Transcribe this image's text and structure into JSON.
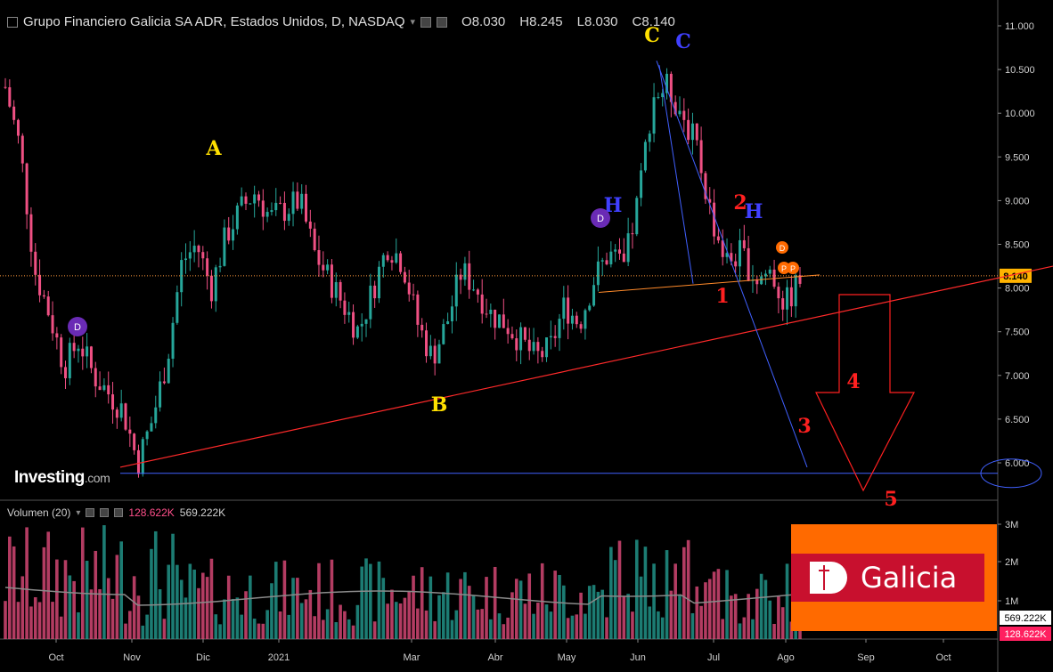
{
  "header": {
    "title": "Grupo Financiero Galicia SA ADR, Estados Unidos, D, NASDAQ",
    "open": "O8.030",
    "high": "H8.245",
    "low": "L8.030",
    "close": "C8.140"
  },
  "volume_header": {
    "label": "Volumen (20)",
    "value1": "128.622K",
    "value2": "569.222K"
  },
  "logo": {
    "brand": "Investing",
    "suffix": ".com"
  },
  "galicia_logo": {
    "text": "Galicia"
  },
  "colors": {
    "up": "#26a69a",
    "down": "#ef5083",
    "trendline": "#ff2a2a",
    "blue_line": "#4060ff",
    "wave_yellow": "#ffe000",
    "wave_blue": "#4040ff",
    "wave_red": "#ff2020",
    "price_tag": "#ffb300"
  },
  "chart_data": {
    "type": "candlestick",
    "title": "Grupo Financiero Galicia SA ADR, Estados Unidos, D, NASDAQ",
    "price_axis": {
      "ticks": [
        "11.000",
        "10.500",
        "10.000",
        "9.500",
        "9.000",
        "8.500",
        "8.000",
        "7.500",
        "7.000",
        "6.500",
        "6.000"
      ],
      "range": [
        5.85,
        11.15
      ],
      "current_price": "8.140"
    },
    "volume_axis": {
      "ticks": [
        "3M",
        "2M",
        "1M"
      ],
      "labels": {
        "ma": "569.222K",
        "last": "128.622K"
      }
    },
    "time_axis": [
      "Oct",
      "Nov",
      "Dic",
      "2021",
      "Mar",
      "Abr",
      "May",
      "Jun",
      "Jul",
      "Ago",
      "Sep",
      "Oct"
    ],
    "price_path": [
      [
        "Sep",
        10.3
      ],
      [
        "Sep",
        9.6
      ],
      [
        "Sep",
        8.2
      ],
      [
        "Sep",
        7.7
      ],
      [
        "Oct",
        7.1
      ],
      [
        "Oct",
        7.4
      ],
      [
        "Oct",
        7.0
      ],
      [
        "Oct",
        6.8
      ],
      [
        "Oct",
        6.6
      ],
      [
        "Nov",
        6.0
      ],
      [
        "Nov",
        6.5
      ],
      [
        "Nov",
        7.2
      ],
      [
        "Nov",
        8.3
      ],
      [
        "Nov",
        8.5
      ],
      [
        "Nov",
        8.0
      ],
      [
        "Dic",
        8.6
      ],
      [
        "Dic",
        8.9
      ],
      [
        "Dic",
        9.1
      ],
      [
        "Dic",
        8.8
      ],
      [
        "Dic",
        8.9
      ],
      [
        "2021",
        9.0
      ],
      [
        "2021",
        8.4
      ],
      [
        "2021",
        8.1
      ],
      [
        "2021",
        7.8
      ],
      [
        "2021",
        7.5
      ],
      [
        "2021",
        8.0
      ],
      [
        "2021",
        8.5
      ],
      [
        "Mar",
        8.3
      ],
      [
        "Mar",
        7.6
      ],
      [
        "Mar",
        7.2
      ],
      [
        "Mar",
        7.6
      ],
      [
        "Mar",
        8.2
      ],
      [
        "Mar",
        8.0
      ],
      [
        "Abr",
        7.7
      ],
      [
        "Abr",
        7.6
      ],
      [
        "Abr",
        7.4
      ],
      [
        "Abr",
        7.2
      ],
      [
        "Abr",
        7.3
      ],
      [
        "May",
        7.8
      ],
      [
        "May",
        7.6
      ],
      [
        "May",
        8.1
      ],
      [
        "May",
        8.4
      ],
      [
        "May",
        8.2
      ],
      [
        "Jun",
        9.0
      ],
      [
        "Jun",
        10.2
      ],
      [
        "Jun",
        10.3
      ],
      [
        "Jun",
        10.0
      ],
      [
        "Jun",
        9.6
      ],
      [
        "Jul",
        8.8
      ],
      [
        "Jul",
        8.3
      ],
      [
        "Jul",
        8.4
      ],
      [
        "Jul",
        8.1
      ],
      [
        "Jul",
        8.2
      ],
      [
        "Ago",
        7.8
      ],
      [
        "Ago",
        8.1
      ]
    ],
    "volume_level": 0.3,
    "annotations": {
      "wave_labels": [
        {
          "text": "A",
          "color": "yellow"
        },
        {
          "text": "B",
          "color": "yellow"
        },
        {
          "text": "C",
          "color": "yellow"
        },
        {
          "text": "C",
          "color": "blue"
        },
        {
          "text": "H",
          "color": "blue"
        },
        {
          "text": "H",
          "color": "blue"
        },
        {
          "text": "1",
          "color": "red"
        },
        {
          "text": "2",
          "color": "red"
        },
        {
          "text": "3",
          "color": "red"
        },
        {
          "text": "4",
          "color": "red"
        },
        {
          "text": "5",
          "color": "red"
        }
      ],
      "markers": [
        "D",
        "D",
        "D",
        "P",
        "P",
        "P"
      ],
      "support_level": "6.000"
    }
  }
}
